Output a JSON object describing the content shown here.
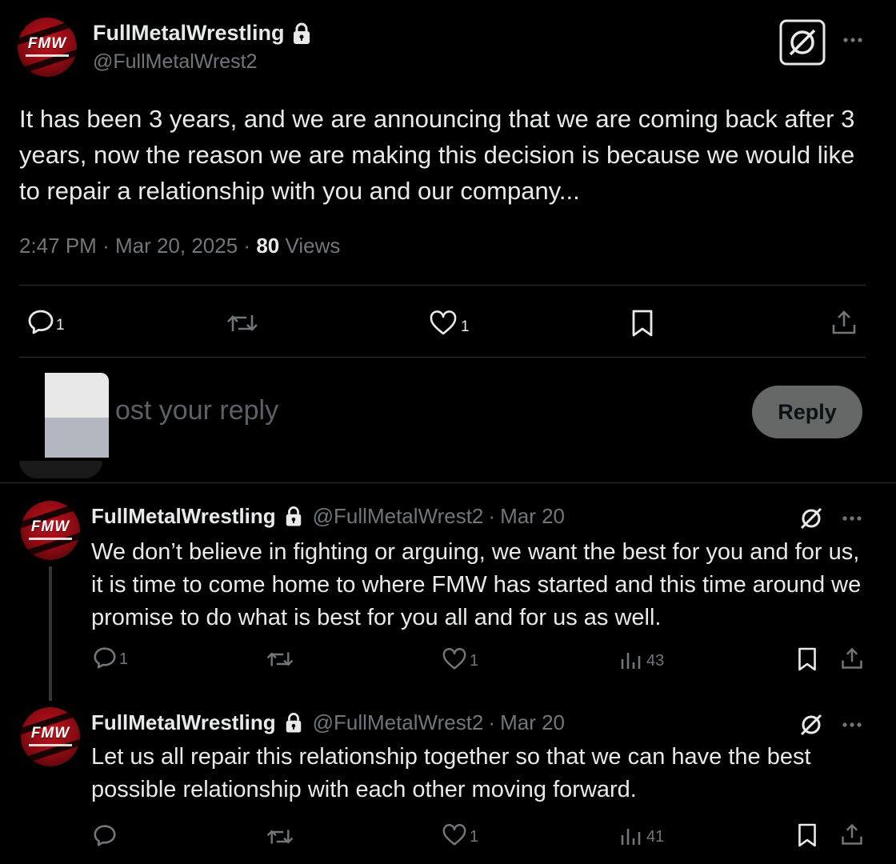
{
  "post": {
    "author_name": "FullMetalWrestling",
    "author_handle": "@FullMetalWrest2",
    "avatar_logo": "FMW",
    "text": "It has been 3 years, and we are announcing that we are coming back after 3 years, now the reason we are making this decision is because we would like to repair a relationship with you and our company...",
    "time": "2:47 PM",
    "date": "Mar 20, 2025",
    "views_count": "80",
    "views_label": "Views",
    "sep": "·",
    "actions": {
      "reply_count": "1",
      "retweet_count": "",
      "like_count": "1"
    }
  },
  "composer": {
    "placeholder": "ost your reply",
    "reply_button": "Reply"
  },
  "replies": [
    {
      "author_name": "FullMetalWrestling",
      "author_handle": "@FullMetalWrest2",
      "date_label": "Mar 20",
      "sep": "·",
      "text": "We don’t believe in fighting or arguing, we want the best for you and for us, it is time to come home to where FMW has started and this time around we promise to do what is best for you all and for us as well.",
      "reply_count": "1",
      "like_count": "1",
      "views_count": "43"
    },
    {
      "author_name": "FullMetalWrestling",
      "author_handle": "@FullMetalWrest2",
      "date_label": "Mar 20",
      "sep": "·",
      "text": "Let us all repair this relationship together so that we can have the best possible relationship with each other moving forward.",
      "reply_count": "",
      "like_count": "1",
      "views_count": "41"
    }
  ],
  "icons": {
    "lock": "lock-icon",
    "grok": "grok-icon",
    "more": "more-icon",
    "reply": "reply-icon",
    "retweet": "retweet-icon",
    "like": "heart-icon",
    "bookmark": "bookmark-icon",
    "share": "share-icon",
    "views": "views-icon"
  },
  "colors": {
    "background": "#000000",
    "text": "#e7e9ea",
    "muted": "#71767b",
    "divider": "#2f3336",
    "avatar_red": "#c1121c"
  }
}
